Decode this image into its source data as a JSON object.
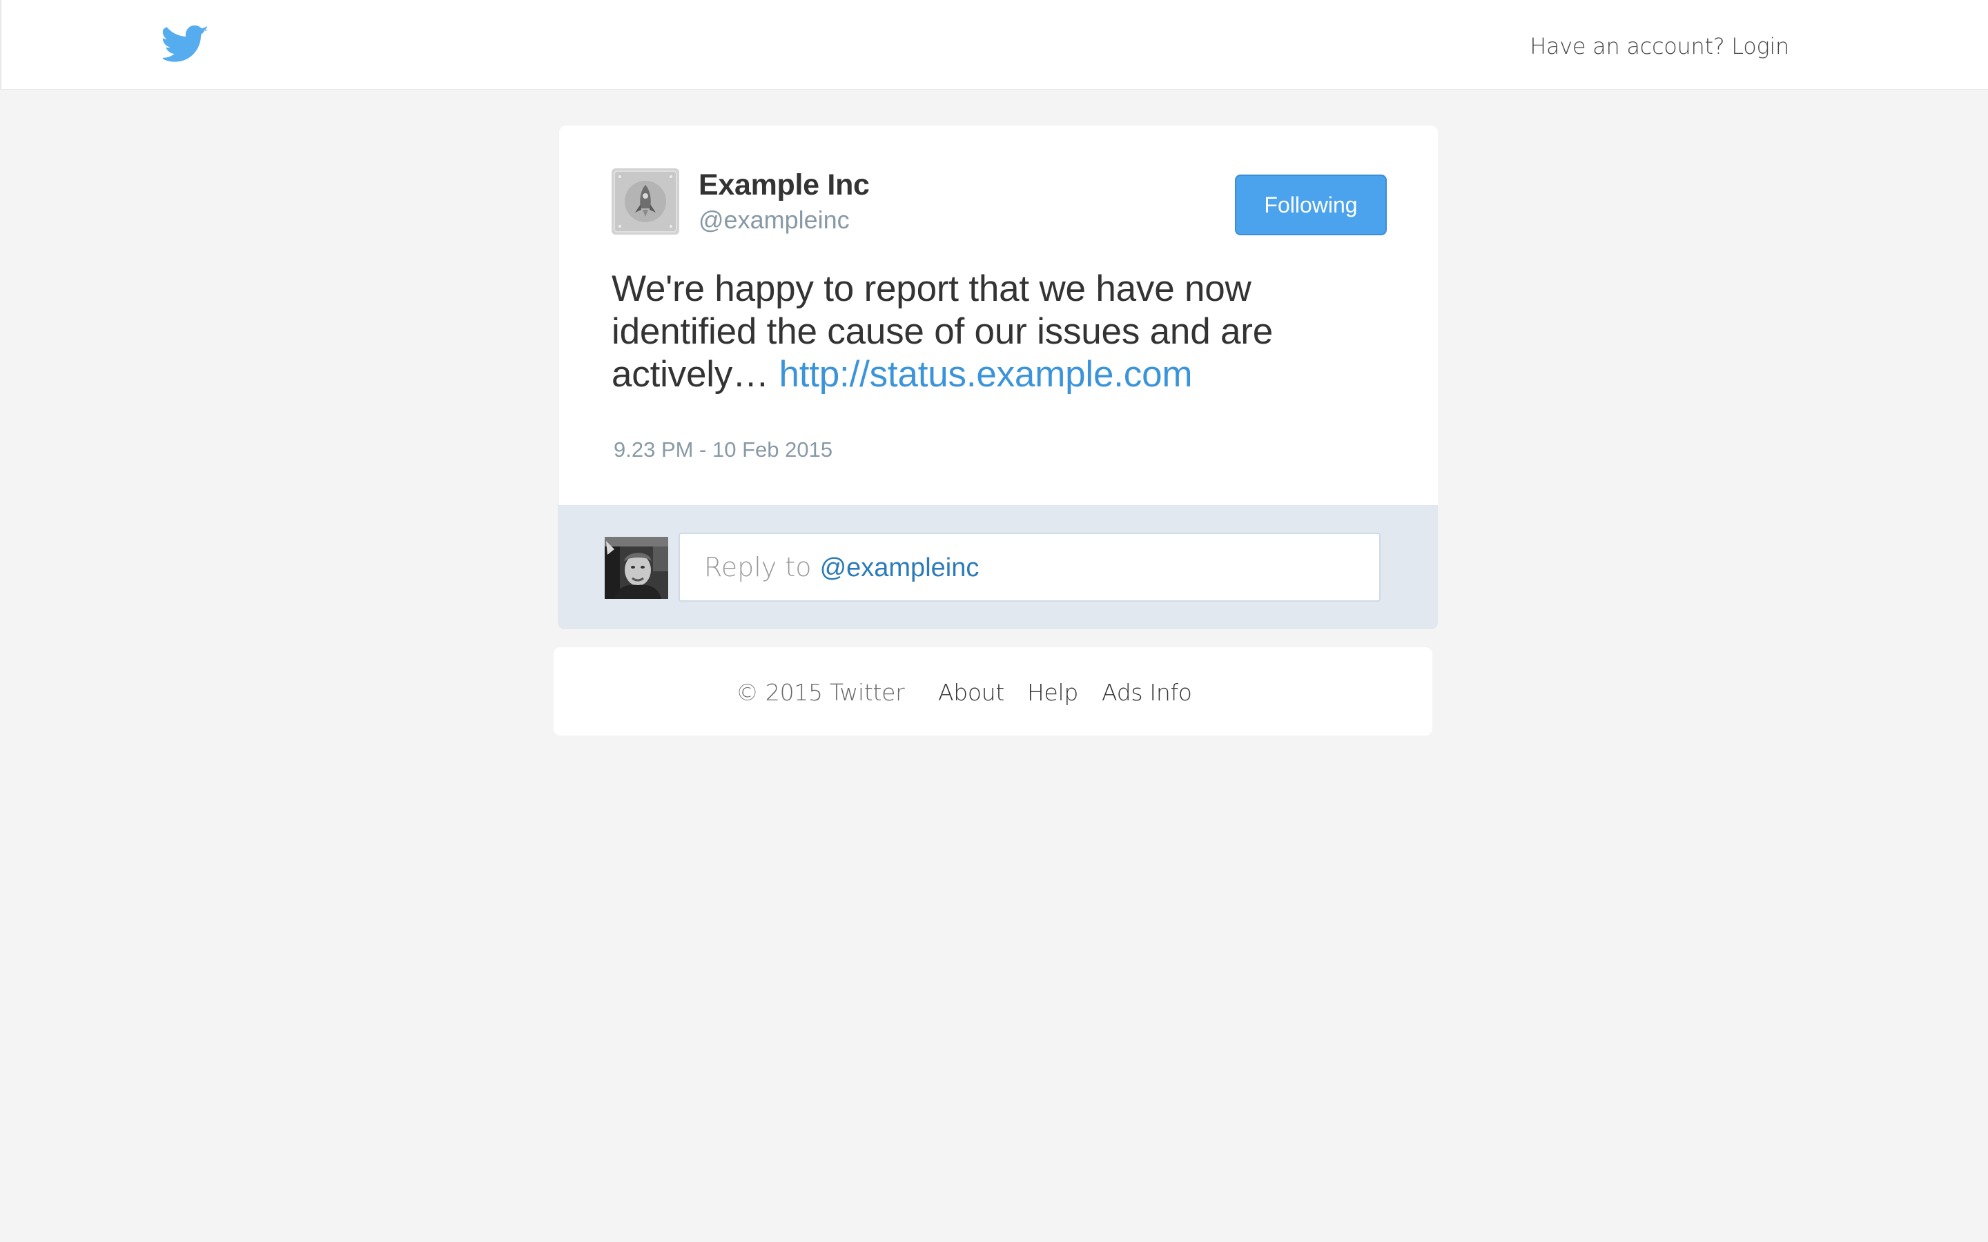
{
  "header": {
    "login_label": "Have an account? Login",
    "brand_color": "#55acee"
  },
  "tweet": {
    "author_name": "Example Inc",
    "author_handle": "@exampleinc",
    "follow_label": "Following",
    "text": "We're happy to report that we have now identified the cause of our issues and are actively… ",
    "link": "http://status.example.com",
    "timestamp": "9.23 PM - 10 Feb 2015",
    "avatar_icon": "rocket-icon",
    "link_color": "#3b94d9"
  },
  "reply": {
    "prefix": "Reply to ",
    "mention": "@exampleinc",
    "avatar_icon": "user-photo"
  },
  "footer": {
    "copyright": "©  2015 Twitter",
    "links": [
      "About",
      "Help",
      "Ads Info"
    ]
  }
}
